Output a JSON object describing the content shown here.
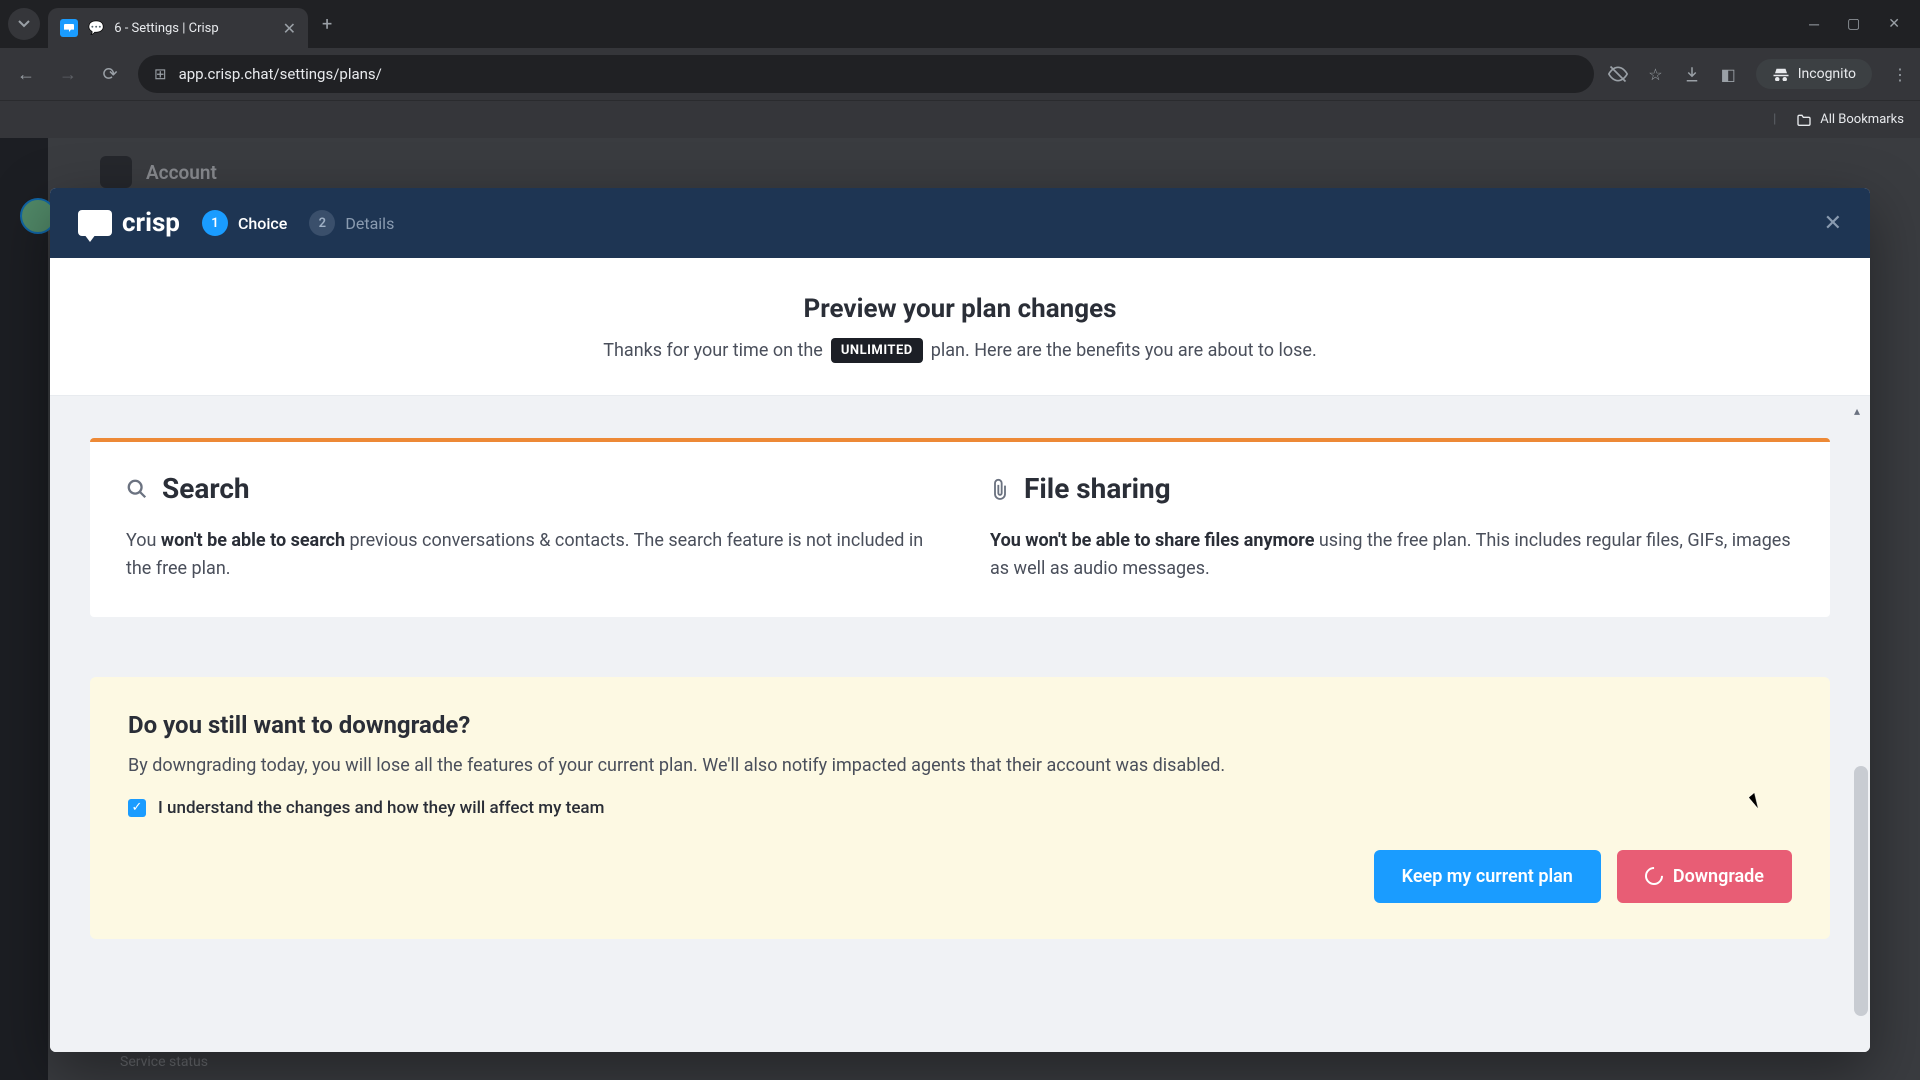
{
  "browser": {
    "tab_title": "6 - Settings | Crisp",
    "url": "app.crisp.chat/settings/plans/",
    "incognito_label": "Incognito",
    "all_bookmarks": "All Bookmarks"
  },
  "bg": {
    "section": "Account",
    "footer": "Service status"
  },
  "modal": {
    "brand": "crisp",
    "steps": [
      {
        "num": "1",
        "label": "Choice"
      },
      {
        "num": "2",
        "label": "Details"
      }
    ],
    "intro": {
      "title": "Preview your plan changes",
      "sub_pre": "Thanks for your time on the",
      "plan_badge": "UNLIMITED",
      "sub_post": "plan. Here are the benefits you are about to lose."
    },
    "features": [
      {
        "title": "Search",
        "desc_pre": "You ",
        "desc_bold": "won't be able to search",
        "desc_post": " previous conversations & contacts. The search feature is not included in the free plan."
      },
      {
        "title": "File sharing",
        "desc_pre": "",
        "desc_bold": "You won't be able to share files anymore",
        "desc_post": " using the free plan. This includes regular files, GIFs, images as well as audio messages."
      }
    ],
    "confirm": {
      "title": "Do you still want to downgrade?",
      "sub": "By downgrading today, you will lose all the features of your current plan. We'll also notify impacted agents that their account was disabled.",
      "checkbox_label": "I understand the changes and how they will affect my team",
      "keep_button": "Keep my current plan",
      "downgrade_button": "Downgrade"
    }
  }
}
